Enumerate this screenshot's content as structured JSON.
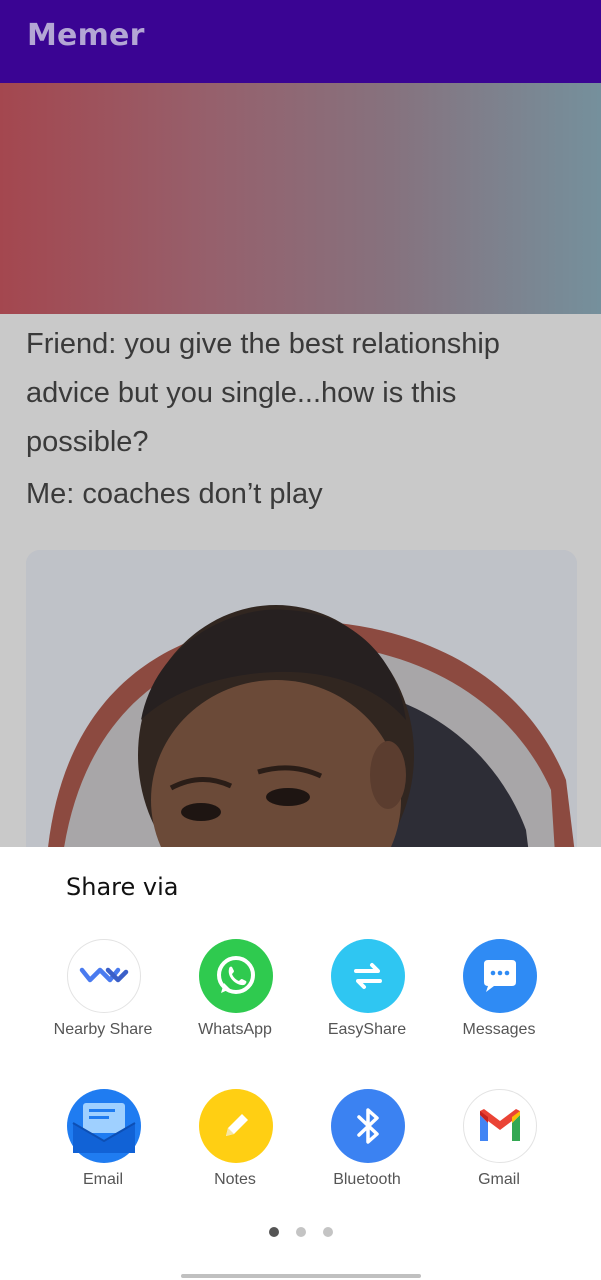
{
  "app": {
    "title": "Memer"
  },
  "post": {
    "text_line1": "Friend: you give the best relationship advice but you single...how is this possible?",
    "text_line2": "Me: coaches don’t play"
  },
  "share_sheet": {
    "title": "Share via",
    "items": [
      {
        "label": "Nearby Share",
        "icon": "nearby-share-icon",
        "color": "#ffffff"
      },
      {
        "label": "WhatsApp",
        "icon": "whatsapp-icon",
        "color": "#2fca4f"
      },
      {
        "label": "EasyShare",
        "icon": "easyshare-icon",
        "color": "#2fc6f2"
      },
      {
        "label": "Messages",
        "icon": "messages-icon",
        "color": "#2f8bf4"
      },
      {
        "label": "Email",
        "icon": "email-icon",
        "color": "#1f7cf1"
      },
      {
        "label": "Notes",
        "icon": "notes-icon",
        "color": "#ffcf13"
      },
      {
        "label": "Bluetooth",
        "icon": "bluetooth-icon",
        "color": "#3b82f2"
      },
      {
        "label": "Gmail",
        "icon": "gmail-icon",
        "color": "#ffffff"
      }
    ],
    "page_indicator": {
      "pages": 3,
      "current": 1
    }
  }
}
